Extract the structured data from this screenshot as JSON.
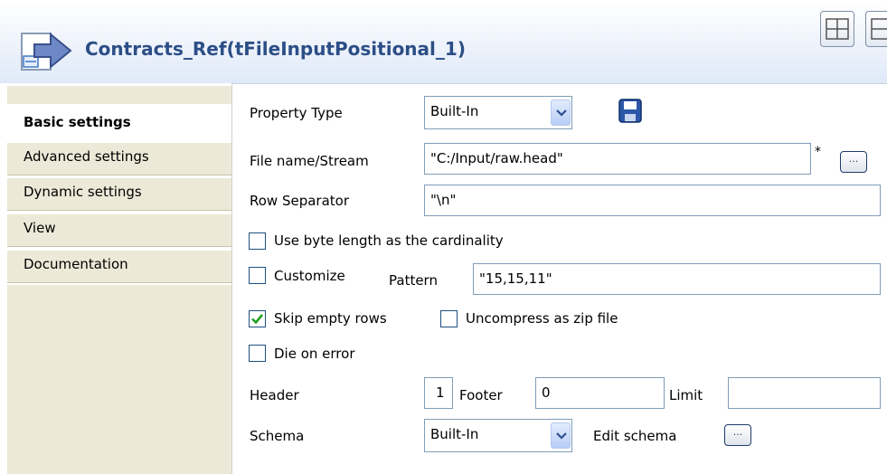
{
  "header": {
    "title": "Contracts_Ref(tFileInputPositional_1)",
    "icon": "file-input-arrow-icon",
    "view_buttons": [
      "layout-view-icon",
      "layout-view-alt-icon"
    ]
  },
  "sidebar": {
    "tabs": [
      {
        "label": "Basic settings",
        "active": true
      },
      {
        "label": "Advanced settings",
        "active": false
      },
      {
        "label": "Dynamic settings",
        "active": false
      },
      {
        "label": "View",
        "active": false
      },
      {
        "label": "Documentation",
        "active": false
      }
    ]
  },
  "form": {
    "property_type": {
      "label": "Property Type",
      "value": "Built-In",
      "save_icon": "save-icon"
    },
    "file_name": {
      "label": "File name/Stream",
      "value": "\"C:/Input/raw.head\"",
      "required_marker": "*",
      "browse_label": "..."
    },
    "row_separator": {
      "label": "Row Separator",
      "value": "\"\\n\""
    },
    "use_byte_length": {
      "label": "Use byte length as the cardinality",
      "checked": false
    },
    "customize": {
      "label": "Customize",
      "checked": false
    },
    "pattern": {
      "label": "Pattern",
      "value": "\"15,15,11\""
    },
    "skip_empty_rows": {
      "label": "Skip empty rows",
      "checked": true
    },
    "uncompress_zip": {
      "label": "Uncompress as zip file",
      "checked": false
    },
    "die_on_error": {
      "label": "Die on error",
      "checked": false
    },
    "header": {
      "label": "Header",
      "value": "1"
    },
    "footer": {
      "label": "Footer",
      "value": "0"
    },
    "limit": {
      "label": "Limit",
      "value": ""
    },
    "schema": {
      "label": "Schema",
      "value": "Built-In",
      "edit_label": "Edit schema",
      "edit_button_label": "..."
    }
  },
  "colors": {
    "title": "#2c4e86",
    "tab_bg": "#ece9d8",
    "field_border": "#7f9db9",
    "check_mark": "#21a121"
  }
}
